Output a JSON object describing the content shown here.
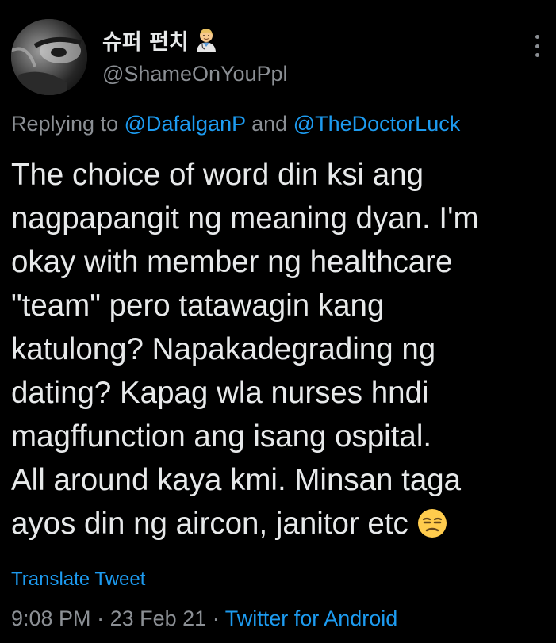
{
  "tweet": {
    "display_name": "슈퍼 펀치",
    "name_emoji": "man-health-worker-emoji",
    "handle": "@ShameOnYouPpl",
    "replying_prefix": "Replying to",
    "replying_conjunction": "and",
    "reply_mentions": [
      "@DafalganP",
      "@TheDoctorLuck"
    ],
    "body_lines": [
      "The choice of word din ksi ang",
      "nagpapangit ng meaning dyan. I'm",
      "okay with member ng healthcare",
      "\"team\" pero tatawagin kang",
      "katulong? Napakadegrading ng",
      "dating? Kapag wla nurses hndi",
      "magffunction ang isang ospital.",
      "All around kaya kmi. Minsan taga",
      "ayos din ng aircon, janitor etc"
    ],
    "body_emoji": "unamused-face-emoji",
    "translate_label": "Translate Tweet",
    "time": "9:08 PM",
    "date": "23 Feb 21",
    "separator": "·",
    "source": "Twitter for Android"
  },
  "icons": {
    "more": "more-vertical-icon"
  },
  "colors": {
    "background": "#000000",
    "text": "#e7e9ea",
    "secondary": "#8b8f94",
    "link": "#1d9bf0"
  }
}
